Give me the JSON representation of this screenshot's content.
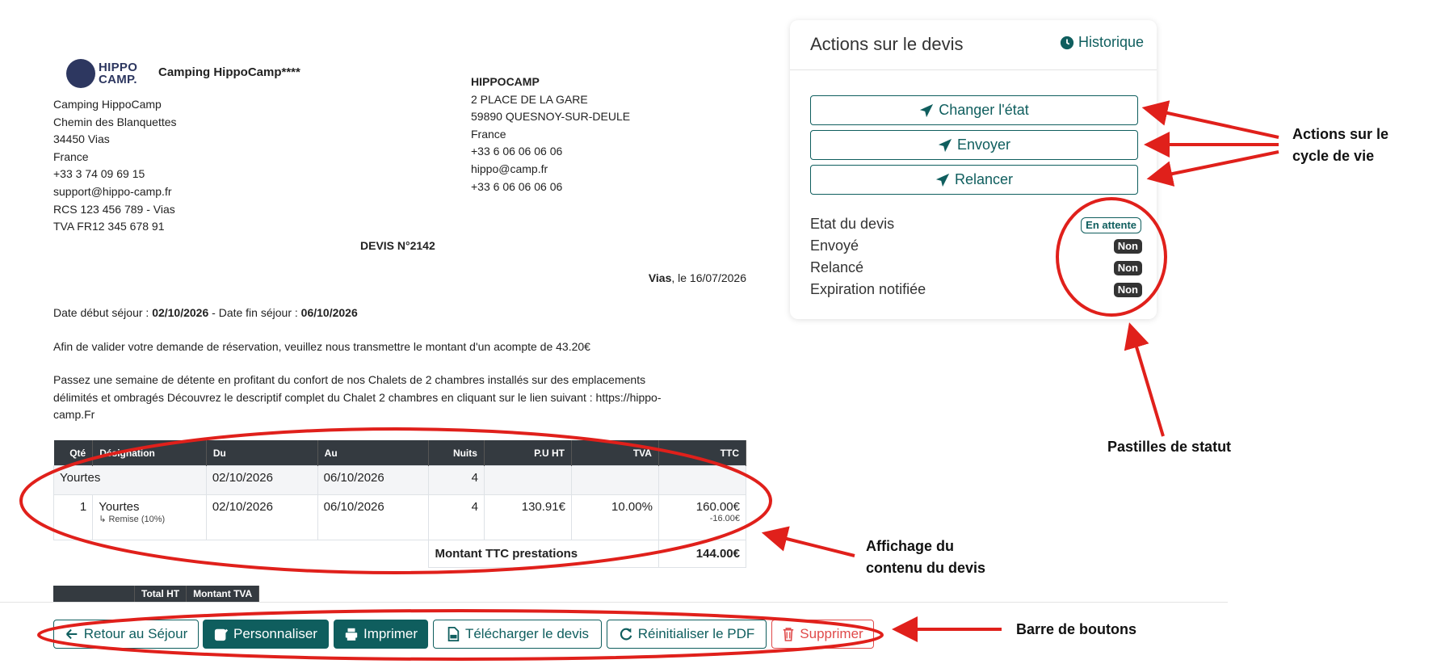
{
  "company": {
    "logo_text_line1": "HIPPO",
    "logo_text_line2": "CAMP.",
    "name": "Camping HippoCamp****",
    "lines": [
      "Camping HippoCamp",
      "Chemin des Blanquettes",
      "34450 Vias",
      "France",
      "+33 3 74 09 69 15",
      "support@hippo-camp.fr",
      "RCS 123 456 789 - Vias",
      "TVA FR12 345 678 91"
    ]
  },
  "client": {
    "name": "HIPPOCAMP",
    "lines": [
      "2 PLACE DE LA GARE",
      "59890 QUESNOY-SUR-DEULE",
      "France",
      "+33 6 06 06 06 06",
      "hippo@camp.fr",
      "+33 6 06 06 06 06"
    ]
  },
  "quote": {
    "title": "DEVIS N°2142",
    "place": "Vias",
    "date_text": ", le 16/07/2026",
    "stay_start_label": "Date début séjour : ",
    "stay_start": "02/10/2026",
    "stay_sep": " - Date fin séjour : ",
    "stay_end": "06/10/2026",
    "deposit_text": "Afin de valider votre demande de réservation, veuillez nous transmettre le montant d'un acompte de 43.20€",
    "description_lines": [
      "Passez une semaine de détente en profitant du confort de nos Chalets de 2 chambres installés sur des emplacements",
      "délimités et ombragés Découvrez le descriptif complet du Chalet 2 chambres en cliquant sur le lien suivant : https://hippo-",
      "camp.Fr"
    ]
  },
  "table": {
    "headers": [
      "Qté",
      "Désignation",
      "Du",
      "Au",
      "Nuits",
      "P.U HT",
      "TVA",
      "TTC"
    ],
    "group": {
      "designation": "Yourtes",
      "du": "02/10/2026",
      "au": "06/10/2026",
      "nuits": "4"
    },
    "row": {
      "qty": "1",
      "designation": "Yourtes",
      "remise": "↳ Remise (10%)",
      "du": "02/10/2026",
      "au": "06/10/2026",
      "nuits": "4",
      "pu_ht": "130.91€",
      "tva": "10.00%",
      "ttc": "160.00€",
      "remise_amount": "-16.00€"
    },
    "total_label": "Montant TTC prestations",
    "total_value": "144.00€",
    "second_headers": [
      "",
      "Total HT",
      "Montant TVA"
    ]
  },
  "buttons": {
    "back": "Retour au Séjour",
    "customize": "Personnaliser",
    "print": "Imprimer",
    "download": "Télécharger le devis",
    "reset": "Réinitialiser le PDF",
    "delete": "Supprimer"
  },
  "panel": {
    "title": "Actions sur le devis",
    "history": "Historique",
    "actions": [
      "Changer l'état",
      "Envoyer",
      "Relancer"
    ],
    "statuses": [
      {
        "label": "Etat du devis",
        "badge": "En attente"
      },
      {
        "label": "Envoyé",
        "badge": "Non"
      },
      {
        "label": "Relancé",
        "badge": "Non"
      },
      {
        "label": "Expiration notifiée",
        "badge": "Non"
      }
    ]
  },
  "annotations": {
    "lifecycle_line1": "Actions sur le",
    "lifecycle_line2": "cycle de vie",
    "status_badges": "Pastilles de statut",
    "content_line1": "Affichage du",
    "content_line2": "contenu du devis",
    "button_bar": "Barre de boutons"
  },
  "colors": {
    "primary": "#0f5e5e",
    "danger": "#e04a4a",
    "annotation": "#e0201b",
    "table_header": "#343a40"
  }
}
